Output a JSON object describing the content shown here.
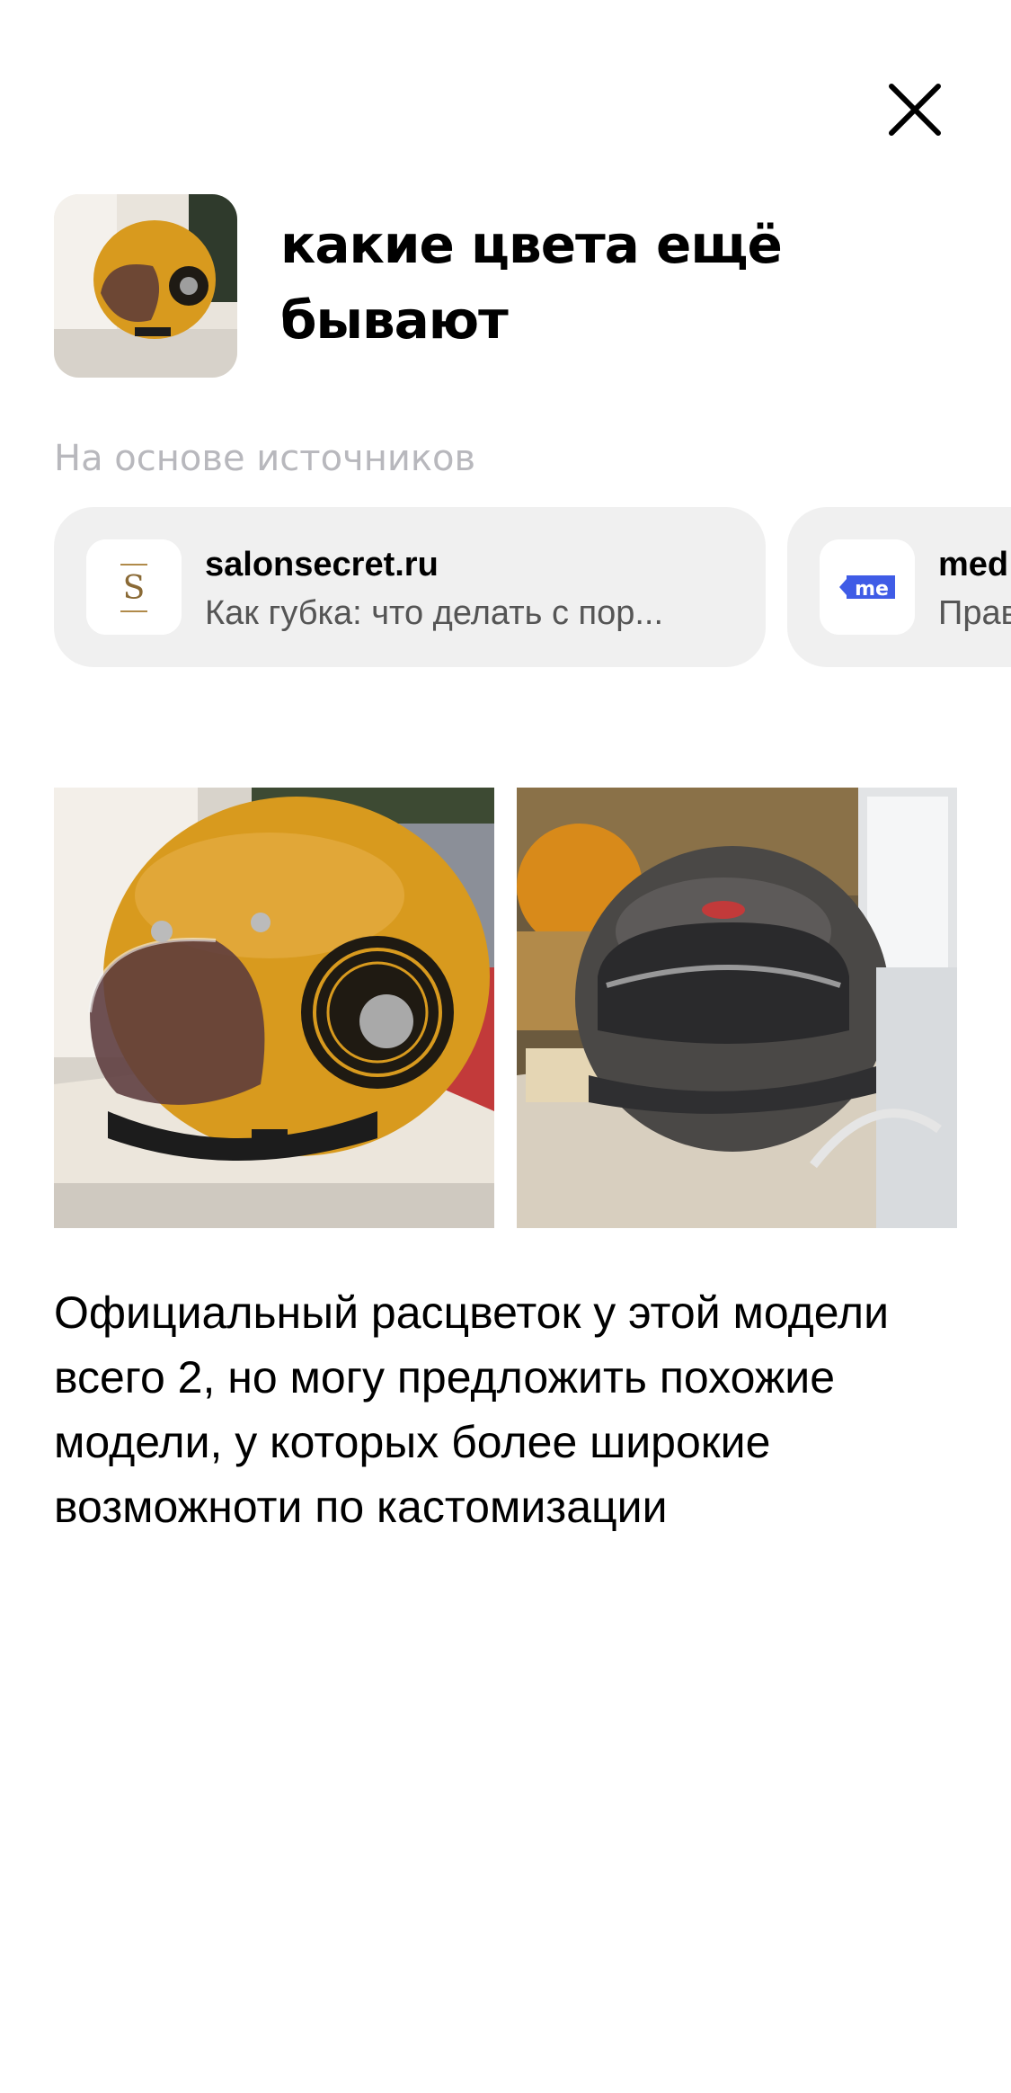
{
  "header": {
    "close_icon": "close-icon"
  },
  "query": {
    "title": "какие цвета ещё бывают",
    "thumbnail": "yellow-helmet-thumbnail"
  },
  "sources": {
    "label": "На основе источников",
    "items": [
      {
        "domain": "salonsecret.ru",
        "snippet": "Как губка: что делать с пор...",
        "icon": "salonsecret-favicon"
      },
      {
        "domain": "med",
        "snippet": "Прав",
        "icon": "me-favicon"
      }
    ]
  },
  "images": [
    {
      "name": "yellow-helmet-photo"
    },
    {
      "name": "grey-helmet-photo"
    }
  ],
  "answer": {
    "text": "Официальный расцветок у этой модели всего 2, но могу предложить похожие модели, у которых более широкие возможноти по кастомизации"
  },
  "colors": {
    "background": "#ffffff",
    "card": "#f0f0f0",
    "muted_text": "#b8b8bd",
    "me_brand": "#3f5ce6",
    "helmet_yellow": "#d89a1e"
  }
}
